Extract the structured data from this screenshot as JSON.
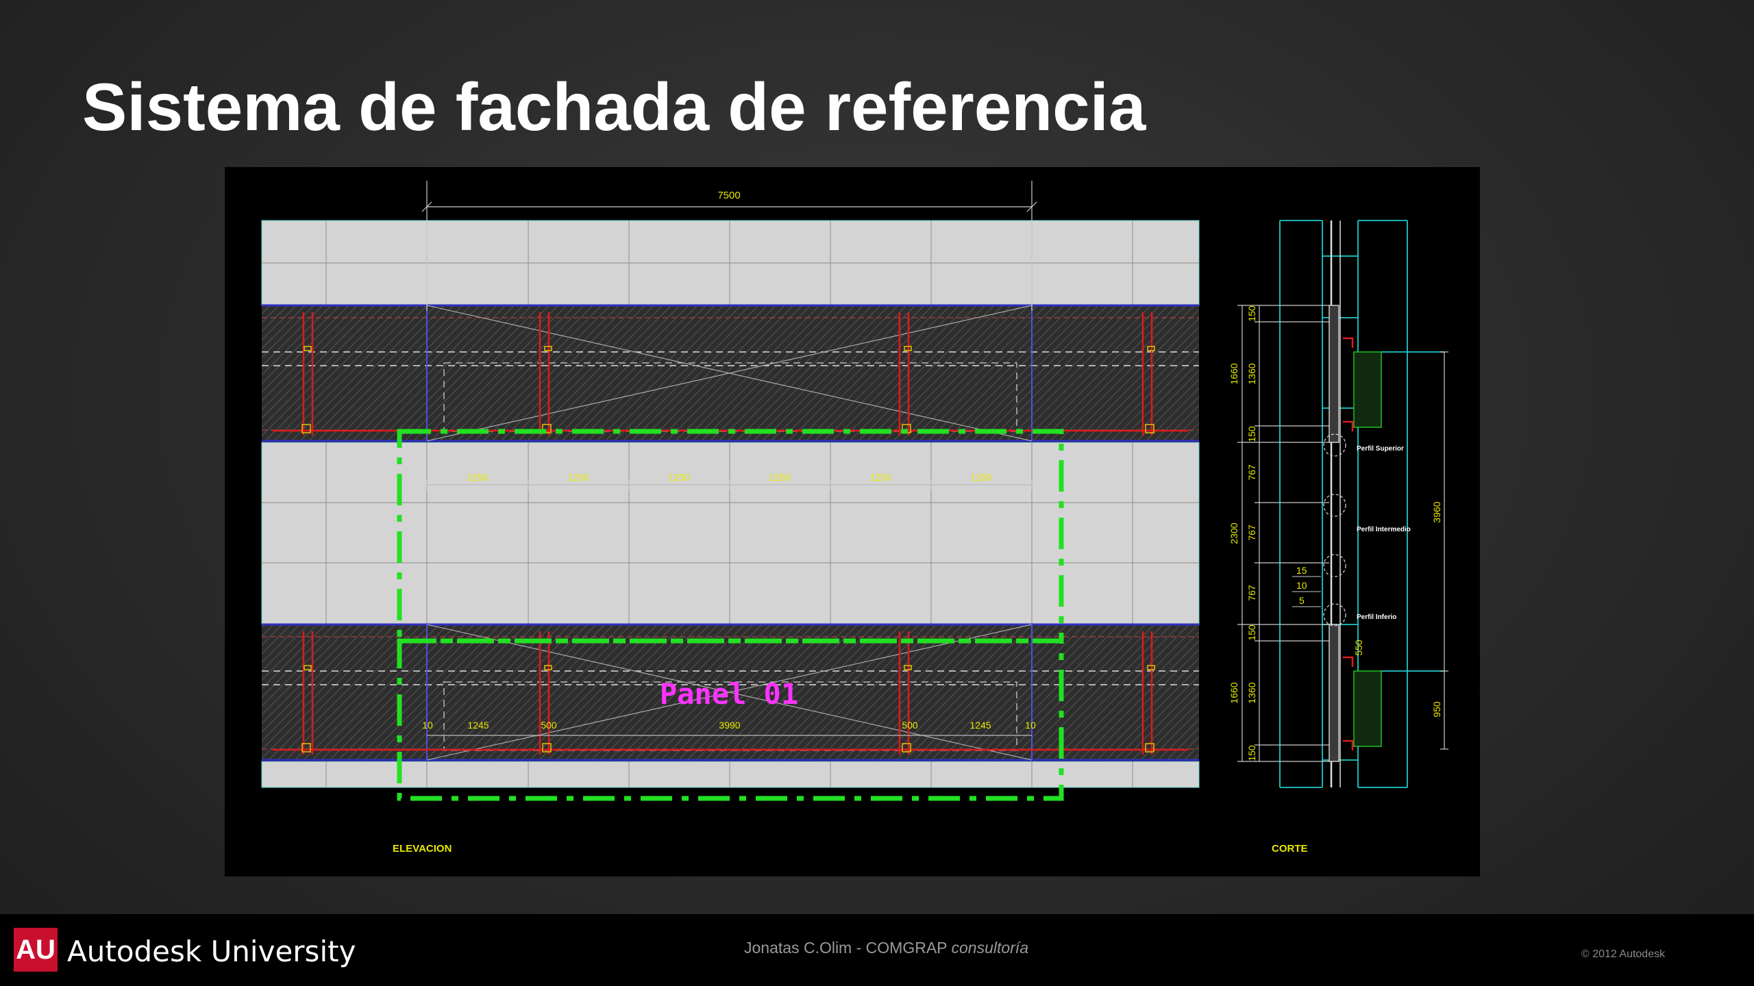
{
  "slide": {
    "title": "Sistema de fachada de referencia"
  },
  "drawing": {
    "top_dimension": "7500",
    "module_dims": [
      "1250",
      "1250",
      "1250",
      "1250",
      "1250",
      "1250"
    ],
    "panel_dims": [
      "10",
      "1245",
      "500",
      "3990",
      "500",
      "1245",
      "10"
    ],
    "panel_label": "Panel 01",
    "elevation_label": "ELEVACION",
    "section_label": "CORTE",
    "section_left_dims": [
      "1660",
      "2300",
      "1660"
    ],
    "section_inner_dims": [
      "150",
      "1360",
      "150",
      "767",
      "767",
      "767",
      "150",
      "1360",
      "150"
    ],
    "section_right_dims": [
      "3960",
      "950"
    ],
    "section_detail_dims": [
      "15",
      "10",
      "5"
    ],
    "section_small_dim": "550",
    "profile_labels": [
      "Perfil Superior",
      "Perfil Intermedio",
      "Perfil Inferio"
    ],
    "colors": {
      "panel_outline": "#22e022",
      "panel_label": "#ff33ff",
      "dimension": "#e8e800",
      "structure": "#e01a1a",
      "section_line": "#20c8c8",
      "glass": "#d4d4d4"
    }
  },
  "footer": {
    "logo_text": "AU",
    "brand": "Autodesk University",
    "credit_name": "Jonatas C.Olim - COMGRAP",
    "credit_company": "consultoría",
    "copyright": "© 2012 Autodesk"
  }
}
